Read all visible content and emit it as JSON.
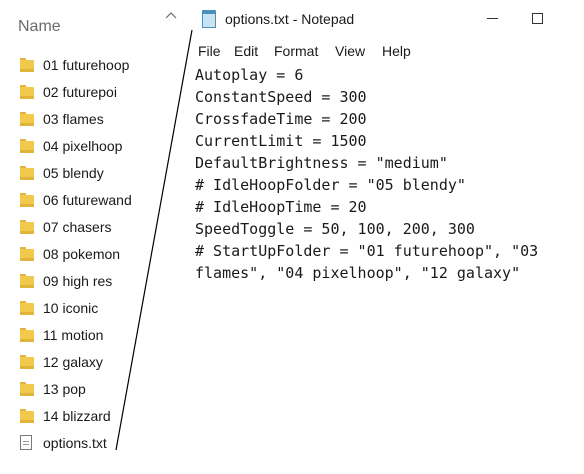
{
  "explorer": {
    "column_header": "Name",
    "items": [
      {
        "label": "01 futurehoop",
        "type": "folder"
      },
      {
        "label": "02 futurepoi",
        "type": "folder"
      },
      {
        "label": "03 flames",
        "type": "folder"
      },
      {
        "label": "04 pixelhoop",
        "type": "folder"
      },
      {
        "label": "05 blendy",
        "type": "folder"
      },
      {
        "label": "06 futurewand",
        "type": "folder"
      },
      {
        "label": "07 chasers",
        "type": "folder"
      },
      {
        "label": "08 pokemon",
        "type": "folder"
      },
      {
        "label": "09 high res",
        "type": "folder"
      },
      {
        "label": "10 iconic",
        "type": "folder"
      },
      {
        "label": "11 motion",
        "type": "folder"
      },
      {
        "label": "12 galaxy",
        "type": "folder"
      },
      {
        "label": "13 pop",
        "type": "folder"
      },
      {
        "label": "14 blizzard",
        "type": "folder"
      },
      {
        "label": "options.txt",
        "type": "text-file"
      }
    ]
  },
  "notepad": {
    "title": "options.txt - Notepad",
    "icon": "notepad-icon",
    "menu": [
      "File",
      "Edit",
      "Format",
      "View",
      "Help"
    ],
    "lines": [
      "Autoplay = 6",
      "ConstantSpeed = 300",
      "CrossfadeTime = 200",
      "CurrentLimit = 1500",
      "DefaultBrightness = \"medium\"",
      "# IdleHoopFolder = \"05 blendy\"",
      "# IdleHoopTime = 20",
      "SpeedToggle = 50, 100, 200, 300",
      "# StartUpFolder = \"01 futurehoop\", \"03",
      "flames\", \"04 pixelhoop\", \"12 galaxy\""
    ]
  },
  "colors": {
    "folder": "#f2c94c",
    "text": "#1a1a1a",
    "header_text": "#6b6b6b"
  }
}
